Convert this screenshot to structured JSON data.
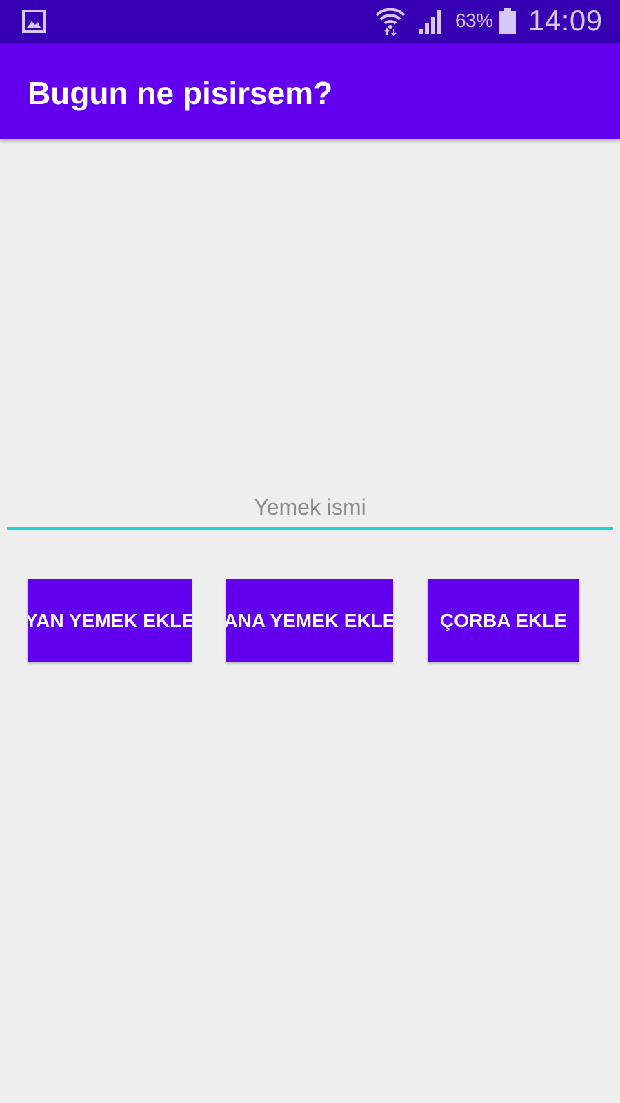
{
  "status_bar": {
    "battery_percent": "63%",
    "time": "14:09",
    "icons": [
      "gallery-icon",
      "wifi-icon",
      "signal-icon",
      "battery-icon"
    ],
    "color": "#3700b3"
  },
  "app_bar": {
    "title": "Bugun ne pisirsem?",
    "color": "#6200ee"
  },
  "food_input": {
    "placeholder": "Yemek ismi",
    "value": "",
    "underline_color": "#1fd4d0"
  },
  "buttons": {
    "side_dish": "YAN YEMEK EKLE",
    "main_dish": "ANA YEMEK EKLE",
    "soup": "ÇORBA EKLE",
    "color": "#6200ee"
  }
}
